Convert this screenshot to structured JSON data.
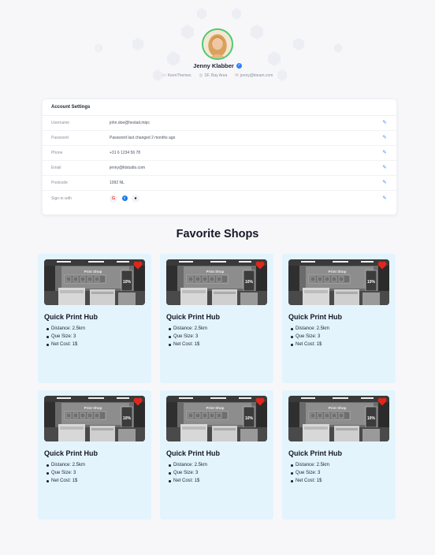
{
  "profile": {
    "name": "Jenny Klabber",
    "meta": [
      {
        "icon": "profile-card-icon",
        "text": "KeenThemes"
      },
      {
        "icon": "map-pin-icon",
        "text": "SF, Bay Area"
      },
      {
        "icon": "mail-icon",
        "text": "jenny@kteam.com"
      }
    ]
  },
  "settings": {
    "title": "Account Settings",
    "rows": [
      {
        "label": "Username",
        "value": "john.doe@hexlad.mipc"
      },
      {
        "label": "Password",
        "value": "Password last changed 2 months ago"
      },
      {
        "label": "Phone",
        "value": "+31 6 1234 56 78"
      },
      {
        "label": "Email",
        "value": "jenny@ktstudio.com"
      },
      {
        "label": "Postcode",
        "value": "1092 NL"
      },
      {
        "label": "Sign-in with",
        "value": ""
      }
    ],
    "social": [
      {
        "icon": "google-icon",
        "glyph": "G"
      },
      {
        "icon": "facebook-icon",
        "glyph": "f"
      },
      {
        "icon": "apple-icon",
        "glyph": ""
      }
    ]
  },
  "shops": {
    "title": "Favorite Shops",
    "items": [
      {
        "name": "Quick Print Hub",
        "distance": "Distance: 2.5km",
        "que": "Que Size: 3",
        "cost": "Net Cost: 1$"
      },
      {
        "name": "Quick Print Hub",
        "distance": "Distance: 2.5km",
        "que": "Que Size: 3",
        "cost": "Net Cost: 1$"
      },
      {
        "name": "Quick Print Hub",
        "distance": "Distance: 2.5km",
        "que": "Que Size: 3",
        "cost": "Net Cost: 1$"
      },
      {
        "name": "Quick Print Hub",
        "distance": "Distance: 2.5km",
        "que": "Que Size: 3",
        "cost": "Net Cost: 1$"
      },
      {
        "name": "Quick Print Hub",
        "distance": "Distance: 2.5km",
        "que": "Que Size: 3",
        "cost": "Net Cost: 1$"
      },
      {
        "name": "Quick Print Hub",
        "distance": "Distance: 2.5km",
        "que": "Que Size: 3",
        "cost": "Net Cost: 1$"
      }
    ],
    "photo_sign": "Print Shop",
    "photo_badge": "10%"
  },
  "colors": {
    "accent": "#3d8cff",
    "card_bg": "#e3f4fd",
    "heart": "#e0261d",
    "avatar_ring": "#4ccb6b"
  }
}
